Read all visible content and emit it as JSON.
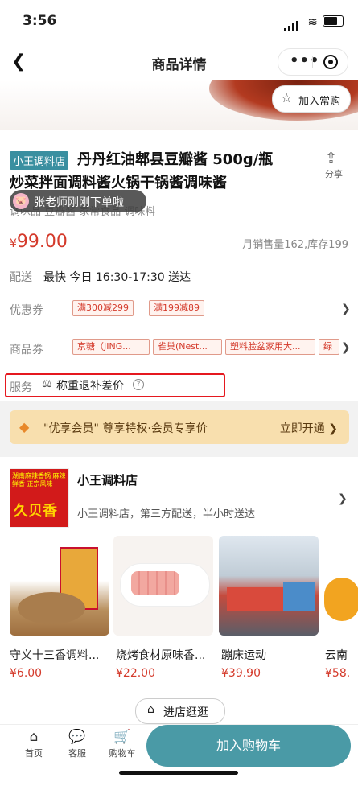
{
  "status": {
    "time": "3:56"
  },
  "nav": {
    "title": "商品详情",
    "dots": "•••"
  },
  "image_overlay": {
    "add_fav": "加入常购"
  },
  "product": {
    "shop_tag": "小王调料店",
    "title_line1": "丹丹红油郫县豆瓣酱 500g/瓶",
    "title_line2": "炒菜拌面调料酱火锅干锅酱调味酱",
    "share": "分享",
    "tags": "调味品 豆瓣酱 家常食品 调味料",
    "price_symbol": "¥",
    "price": "99.00",
    "sales": "月销售量162,库存199"
  },
  "toast": {
    "text": "张老师刚刚下单啦"
  },
  "delivery": {
    "label": "配送",
    "value": "最快 今日 16:30-17:30 送达"
  },
  "coupons": {
    "label": "优惠券",
    "items": [
      "满300减299",
      "满199减89"
    ]
  },
  "product_coupons": {
    "label": "商品券",
    "items": [
      "京糖（JING...",
      "雀巢(Nest...",
      "塑料脸盆家用大...",
      "绿"
    ]
  },
  "service": {
    "label": "服务",
    "value": "称重退补差价",
    "help": "?"
  },
  "vip": {
    "text": "\"优享会员\" 尊享特权·会员专享价",
    "action": "立即开通"
  },
  "store": {
    "name": "小王调料店",
    "desc": "小王调料店，第三方配送，半小时送达",
    "logo_text": "湖南麻辣香锅 麻辣鲜香 正宗风味",
    "logo_brand": "久贝香",
    "visit": "进店逛逛",
    "products": [
      {
        "name": "守义十三香调料...",
        "price": "¥6.00"
      },
      {
        "name": "烧烤食材原味香...",
        "price": "¥22.00"
      },
      {
        "name": "蹦床运动",
        "price": "¥39.90"
      },
      {
        "name": "云南",
        "price": "¥58."
      }
    ]
  },
  "tabbar": {
    "home": "首页",
    "service": "客服",
    "cart": "购物车",
    "add_cart": "加入购物车"
  },
  "colors": {
    "brand": "#4a9aa6",
    "price": "#d43a2b",
    "highlight": "#e5181f",
    "vip_bg": "#f8dfae"
  }
}
